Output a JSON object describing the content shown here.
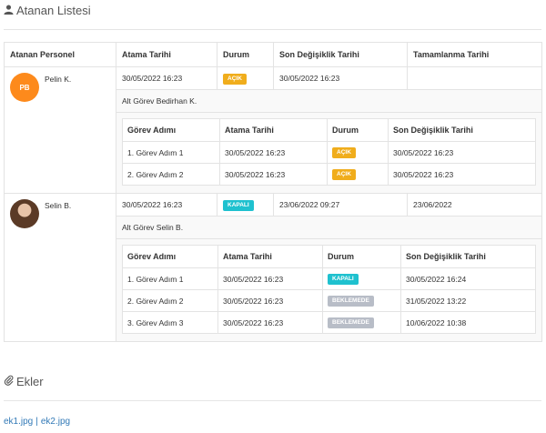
{
  "assignees_section": {
    "title": "Atanan Listesi",
    "icon": "user-icon",
    "columns": [
      "Atanan Personel",
      "Atama Tarihi",
      "Durum",
      "Son Değişiklik Tarihi",
      "Tamamlanma Tarihi"
    ],
    "assignees": [
      {
        "name": "Pelin K.",
        "initials": "PB",
        "avatar_color": "#fd8a1c",
        "assigned_date": "30/05/2022 16:23",
        "status": "AÇIK",
        "last_modified": "30/05/2022 16:23",
        "completed": "",
        "subtask_title": "Alt Görev Bedirhan K.",
        "subtask_columns": [
          "Görev Adımı",
          "Atama Tarihi",
          "Durum",
          "Son Değişiklik Tarihi"
        ],
        "steps": [
          {
            "name": "1. Görev Adım 1",
            "assigned": "30/05/2022 16:23",
            "status": "AÇIK",
            "modified": "30/05/2022 16:23"
          },
          {
            "name": "2. Görev Adım 2",
            "assigned": "30/05/2022 16:23",
            "status": "AÇIK",
            "modified": "30/05/2022 16:23"
          }
        ]
      },
      {
        "name": "Selin B.",
        "assigned_date": "30/05/2022 16:23",
        "status": "KAPALI",
        "last_modified": "23/06/2022 09:27",
        "completed": "23/06/2022",
        "subtask_title": "Alt Görev Selin B.",
        "subtask_columns": [
          "Görev Adımı",
          "Atama Tarihi",
          "Durum",
          "Son Değişiklik Tarihi"
        ],
        "steps": [
          {
            "name": "1. Görev Adım 1",
            "assigned": "30/05/2022 16:23",
            "status": "KAPALI",
            "modified": "30/05/2022 16:24"
          },
          {
            "name": "2. Görev Adım 2",
            "assigned": "30/05/2022 16:23",
            "status": "BEKLEMEDE",
            "modified": "31/05/2022 13:22"
          },
          {
            "name": "3. Görev Adım 3",
            "assigned": "30/05/2022 16:23",
            "status": "BEKLEMEDE",
            "modified": "10/06/2022 10:38"
          }
        ]
      }
    ]
  },
  "attachments_section": {
    "title": "Ekler",
    "icon": "paperclip-icon",
    "files": [
      "ek1.jpg",
      "ek2.jpg"
    ],
    "separator": "|"
  },
  "colors": {
    "open": "#f0ad1c",
    "closed": "#1fc1cf",
    "waiting": "#b8bdc7",
    "link": "#337ab7"
  }
}
